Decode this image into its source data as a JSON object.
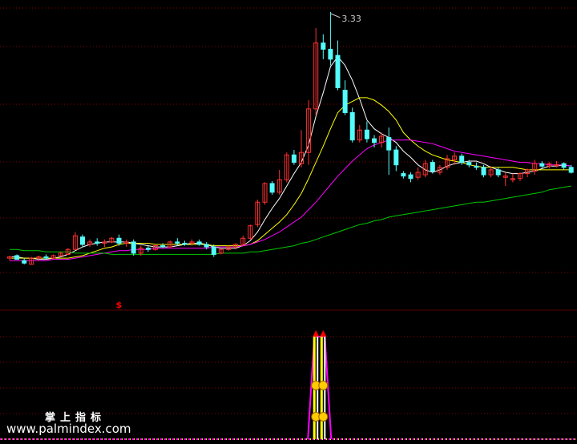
{
  "watermark": {
    "title": "掌上指标",
    "url": "www.palmindex.com"
  },
  "colors": {
    "background": "#000000",
    "grid": "#8b0000",
    "up": "#ff3232",
    "down": "#54fcfc",
    "ma5": "#ffffff",
    "ma10": "#ffff00",
    "ma20": "#ff00ff",
    "ma60": "#00c800",
    "signal": "#ff0000",
    "bar_yellow": "#ffff00",
    "bar_magenta": "#ff00ff",
    "coin": "#ffcc00"
  },
  "chart_data": [
    {
      "type": "candlestick",
      "annotations": [
        {
          "text": "3.33",
          "x": 44,
          "y": 3.33
        }
      ],
      "ylim": [
        1.17,
        3.4
      ],
      "grid": "horizontal-dashed",
      "candles": [
        [
          1.35,
          1.37,
          1.33,
          1.36
        ],
        [
          1.37,
          1.38,
          1.34,
          1.34
        ],
        [
          1.33,
          1.35,
          1.3,
          1.31
        ],
        [
          1.3,
          1.36,
          1.3,
          1.35
        ],
        [
          1.35,
          1.37,
          1.33,
          1.36
        ],
        [
          1.36,
          1.38,
          1.34,
          1.35
        ],
        [
          1.35,
          1.38,
          1.34,
          1.37
        ],
        [
          1.37,
          1.4,
          1.36,
          1.39
        ],
        [
          1.38,
          1.43,
          1.38,
          1.42
        ],
        [
          1.42,
          1.56,
          1.42,
          1.53
        ],
        [
          1.52,
          1.54,
          1.44,
          1.46
        ],
        [
          1.46,
          1.5,
          1.44,
          1.48
        ],
        [
          1.48,
          1.51,
          1.45,
          1.47
        ],
        [
          1.47,
          1.5,
          1.44,
          1.48
        ],
        [
          1.48,
          1.52,
          1.47,
          1.51
        ],
        [
          1.51,
          1.54,
          1.45,
          1.47
        ],
        [
          1.47,
          1.5,
          1.44,
          1.48
        ],
        [
          1.48,
          1.5,
          1.37,
          1.39
        ],
        [
          1.39,
          1.45,
          1.37,
          1.43
        ],
        [
          1.43,
          1.45,
          1.4,
          1.42
        ],
        [
          1.42,
          1.46,
          1.41,
          1.45
        ],
        [
          1.45,
          1.47,
          1.43,
          1.44
        ],
        [
          1.44,
          1.49,
          1.44,
          1.48
        ],
        [
          1.48,
          1.51,
          1.45,
          1.47
        ],
        [
          1.47,
          1.49,
          1.45,
          1.46
        ],
        [
          1.47,
          1.5,
          1.45,
          1.48
        ],
        [
          1.48,
          1.5,
          1.45,
          1.46
        ],
        [
          1.46,
          1.48,
          1.42,
          1.44
        ],
        [
          1.44,
          1.46,
          1.36,
          1.38
        ],
        [
          1.39,
          1.43,
          1.38,
          1.42
        ],
        [
          1.42,
          1.45,
          1.41,
          1.44
        ],
        [
          1.44,
          1.47,
          1.42,
          1.46
        ],
        [
          1.46,
          1.53,
          1.45,
          1.51
        ],
        [
          1.51,
          1.62,
          1.5,
          1.61
        ],
        [
          1.62,
          1.82,
          1.6,
          1.8
        ],
        [
          1.8,
          1.96,
          1.78,
          1.95
        ],
        [
          1.95,
          1.97,
          1.86,
          1.88
        ],
        [
          1.88,
          2.06,
          1.86,
          1.98
        ],
        [
          1.98,
          2.2,
          1.96,
          2.18
        ],
        [
          2.18,
          2.22,
          2.1,
          2.12
        ],
        [
          2.11,
          2.38,
          2.08,
          2.2
        ],
        [
          2.2,
          2.62,
          2.1,
          2.55
        ],
        [
          2.55,
          3.2,
          2.5,
          3.08
        ],
        [
          3.08,
          3.15,
          2.95,
          3.03
        ],
        [
          3.03,
          3.33,
          2.9,
          2.95
        ],
        [
          2.98,
          3.1,
          2.7,
          2.72
        ],
        [
          2.7,
          2.78,
          2.5,
          2.52
        ],
        [
          2.52,
          2.56,
          2.28,
          2.3
        ],
        [
          2.3,
          2.42,
          2.28,
          2.38
        ],
        [
          2.38,
          2.45,
          2.28,
          2.31
        ],
        [
          2.31,
          2.34,
          2.24,
          2.28
        ],
        [
          2.28,
          2.36,
          2.24,
          2.33
        ],
        [
          2.32,
          2.4,
          2.02,
          2.22
        ],
        [
          2.22,
          2.25,
          2.05,
          2.1
        ],
        [
          2.03,
          2.05,
          1.99,
          2.01
        ],
        [
          2.02,
          2.04,
          1.96,
          1.99
        ],
        [
          2.0,
          2.08,
          1.98,
          2.04
        ],
        [
          2.02,
          2.14,
          2.0,
          2.11
        ],
        [
          2.12,
          2.14,
          2.03,
          2.05
        ],
        [
          2.04,
          2.1,
          2.02,
          2.08
        ],
        [
          2.08,
          2.18,
          2.06,
          2.15
        ],
        [
          2.14,
          2.2,
          2.1,
          2.17
        ],
        [
          2.17,
          2.19,
          2.1,
          2.12
        ],
        [
          2.12,
          2.14,
          2.08,
          2.1
        ],
        [
          2.09,
          2.12,
          2.06,
          2.08
        ],
        [
          2.08,
          2.1,
          2.0,
          2.02
        ],
        [
          2.02,
          2.09,
          2.0,
          2.06
        ],
        [
          2.06,
          2.08,
          2.0,
          2.02
        ],
        [
          2.0,
          2.04,
          1.93,
          2.01
        ],
        [
          1.98,
          2.03,
          1.96,
          1.99
        ],
        [
          1.99,
          2.04,
          1.97,
          2.03
        ],
        [
          2.03,
          2.07,
          2.0,
          2.06
        ],
        [
          2.05,
          2.14,
          2.02,
          2.11
        ],
        [
          2.11,
          2.13,
          2.07,
          2.09
        ],
        [
          2.09,
          2.12,
          2.07,
          2.11
        ],
        [
          2.1,
          2.13,
          2.08,
          2.1
        ],
        [
          2.11,
          2.12,
          2.06,
          2.08
        ],
        [
          2.08,
          2.1,
          2.03,
          2.04
        ]
      ],
      "series": [
        {
          "key": "ma5",
          "values": [
            1.36,
            1.36,
            1.35,
            1.35,
            1.34,
            1.34,
            1.35,
            1.36,
            1.38,
            1.41,
            1.44,
            1.46,
            1.47,
            1.48,
            1.48,
            1.48,
            1.48,
            1.47,
            1.46,
            1.45,
            1.44,
            1.44,
            1.44,
            1.45,
            1.46,
            1.47,
            1.47,
            1.46,
            1.44,
            1.43,
            1.43,
            1.43,
            1.45,
            1.49,
            1.56,
            1.66,
            1.75,
            1.83,
            1.93,
            2.03,
            2.12,
            2.26,
            2.49,
            2.68,
            2.89,
            2.97,
            2.9,
            2.78,
            2.63,
            2.46,
            2.39,
            2.35,
            2.32,
            2.28,
            2.21,
            2.16,
            2.1,
            2.06,
            2.04,
            2.06,
            2.09,
            2.11,
            2.12,
            2.13,
            2.13,
            2.11,
            2.08,
            2.06,
            2.04,
            2.03,
            2.03,
            2.04,
            2.05,
            2.07,
            2.09,
            2.09,
            2.1,
            2.09
          ]
        },
        {
          "key": "ma10",
          "values": [
            1.35,
            1.35,
            1.35,
            1.35,
            1.35,
            1.35,
            1.35,
            1.35,
            1.35,
            1.36,
            1.37,
            1.39,
            1.41,
            1.43,
            1.44,
            1.46,
            1.47,
            1.47,
            1.47,
            1.47,
            1.46,
            1.46,
            1.46,
            1.46,
            1.46,
            1.46,
            1.46,
            1.46,
            1.45,
            1.45,
            1.45,
            1.45,
            1.45,
            1.46,
            1.49,
            1.54,
            1.59,
            1.64,
            1.7,
            1.78,
            1.87,
            1.99,
            2.12,
            2.25,
            2.39,
            2.52,
            2.58,
            2.61,
            2.64,
            2.64,
            2.62,
            2.58,
            2.53,
            2.46,
            2.36,
            2.3,
            2.25,
            2.21,
            2.18,
            2.16,
            2.14,
            2.13,
            2.12,
            2.1,
            2.09,
            2.08,
            2.08,
            2.08,
            2.08,
            2.08,
            2.07,
            2.06,
            2.06,
            2.06,
            2.06,
            2.06,
            2.06,
            2.06
          ]
        },
        {
          "key": "ma20",
          "values": [
            1.33,
            1.33,
            1.33,
            1.33,
            1.33,
            1.33,
            1.34,
            1.34,
            1.34,
            1.35,
            1.36,
            1.37,
            1.38,
            1.39,
            1.4,
            1.41,
            1.41,
            1.42,
            1.42,
            1.42,
            1.43,
            1.43,
            1.43,
            1.43,
            1.43,
            1.43,
            1.43,
            1.43,
            1.44,
            1.44,
            1.44,
            1.44,
            1.45,
            1.46,
            1.48,
            1.5,
            1.53,
            1.56,
            1.6,
            1.64,
            1.68,
            1.74,
            1.8,
            1.87,
            1.94,
            2.01,
            2.07,
            2.13,
            2.18,
            2.23,
            2.26,
            2.28,
            2.3,
            2.3,
            2.3,
            2.3,
            2.29,
            2.28,
            2.27,
            2.25,
            2.23,
            2.21,
            2.2,
            2.19,
            2.18,
            2.17,
            2.16,
            2.15,
            2.14,
            2.13,
            2.12,
            2.12,
            2.11,
            2.11,
            2.1,
            2.1,
            2.1,
            2.09
          ]
        },
        {
          "key": "ma60",
          "values": [
            1.42,
            1.42,
            1.41,
            1.41,
            1.41,
            1.4,
            1.4,
            1.4,
            1.4,
            1.39,
            1.39,
            1.39,
            1.39,
            1.39,
            1.38,
            1.38,
            1.38,
            1.38,
            1.38,
            1.38,
            1.38,
            1.38,
            1.38,
            1.38,
            1.38,
            1.38,
            1.38,
            1.38,
            1.38,
            1.39,
            1.39,
            1.39,
            1.39,
            1.4,
            1.4,
            1.41,
            1.42,
            1.43,
            1.44,
            1.45,
            1.47,
            1.48,
            1.5,
            1.52,
            1.54,
            1.56,
            1.58,
            1.6,
            1.62,
            1.63,
            1.65,
            1.66,
            1.68,
            1.69,
            1.7,
            1.71,
            1.72,
            1.73,
            1.74,
            1.75,
            1.76,
            1.77,
            1.78,
            1.79,
            1.8,
            1.8,
            1.81,
            1.82,
            1.83,
            1.84,
            1.85,
            1.86,
            1.87,
            1.88,
            1.9,
            1.91,
            1.92,
            1.93
          ]
        }
      ]
    },
    {
      "type": "bar",
      "signals": [
        {
          "x": 42,
          "value": 1
        },
        {
          "x": 43,
          "value": 1
        }
      ],
      "markers": [
        {
          "x": 15,
          "text": "$"
        }
      ]
    }
  ]
}
